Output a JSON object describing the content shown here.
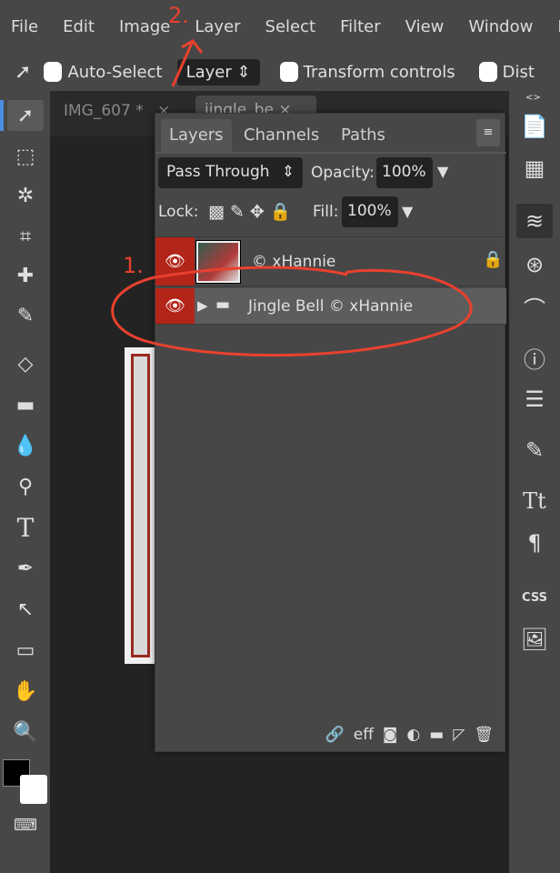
{
  "menu": [
    "File",
    "Edit",
    "Image",
    "Layer",
    "Select",
    "Filter",
    "View",
    "Window",
    "Mo"
  ],
  "options": {
    "auto_select": "Auto-Select",
    "auto_select_mode": "Layer",
    "transform_controls": "Transform controls",
    "distances": "Dist"
  },
  "doc_tabs": [
    {
      "label": "IMG_607 *",
      "close": "×"
    },
    {
      "label": "jingle_be",
      "close": "×"
    }
  ],
  "panel": {
    "tabs": [
      "Layers",
      "Channels",
      "Paths"
    ],
    "active_tab": "Layers",
    "blend_mode": "Pass Through",
    "opacity_label": "Opacity:",
    "opacity": "100%",
    "lock_label": "Lock:",
    "fill_label": "Fill:",
    "fill": "100%",
    "layers": [
      {
        "name": "© xHannie",
        "visible": true,
        "locked": true,
        "type": "image"
      },
      {
        "name": "Jingle Bell © xHannie",
        "visible": true,
        "type": "group",
        "selected": true
      }
    ],
    "footer_icons": [
      "link-icon",
      "effects-icon",
      "mask-icon",
      "adjustment-icon",
      "folder-icon",
      "new-layer-icon",
      "trash-icon"
    ],
    "effects_label": "eff"
  },
  "annotations": {
    "step1": "1.",
    "step2": "2."
  },
  "colors": {
    "eye_column": "#b32419",
    "annotation": "#e8412e",
    "accent": "#4a90e2"
  }
}
